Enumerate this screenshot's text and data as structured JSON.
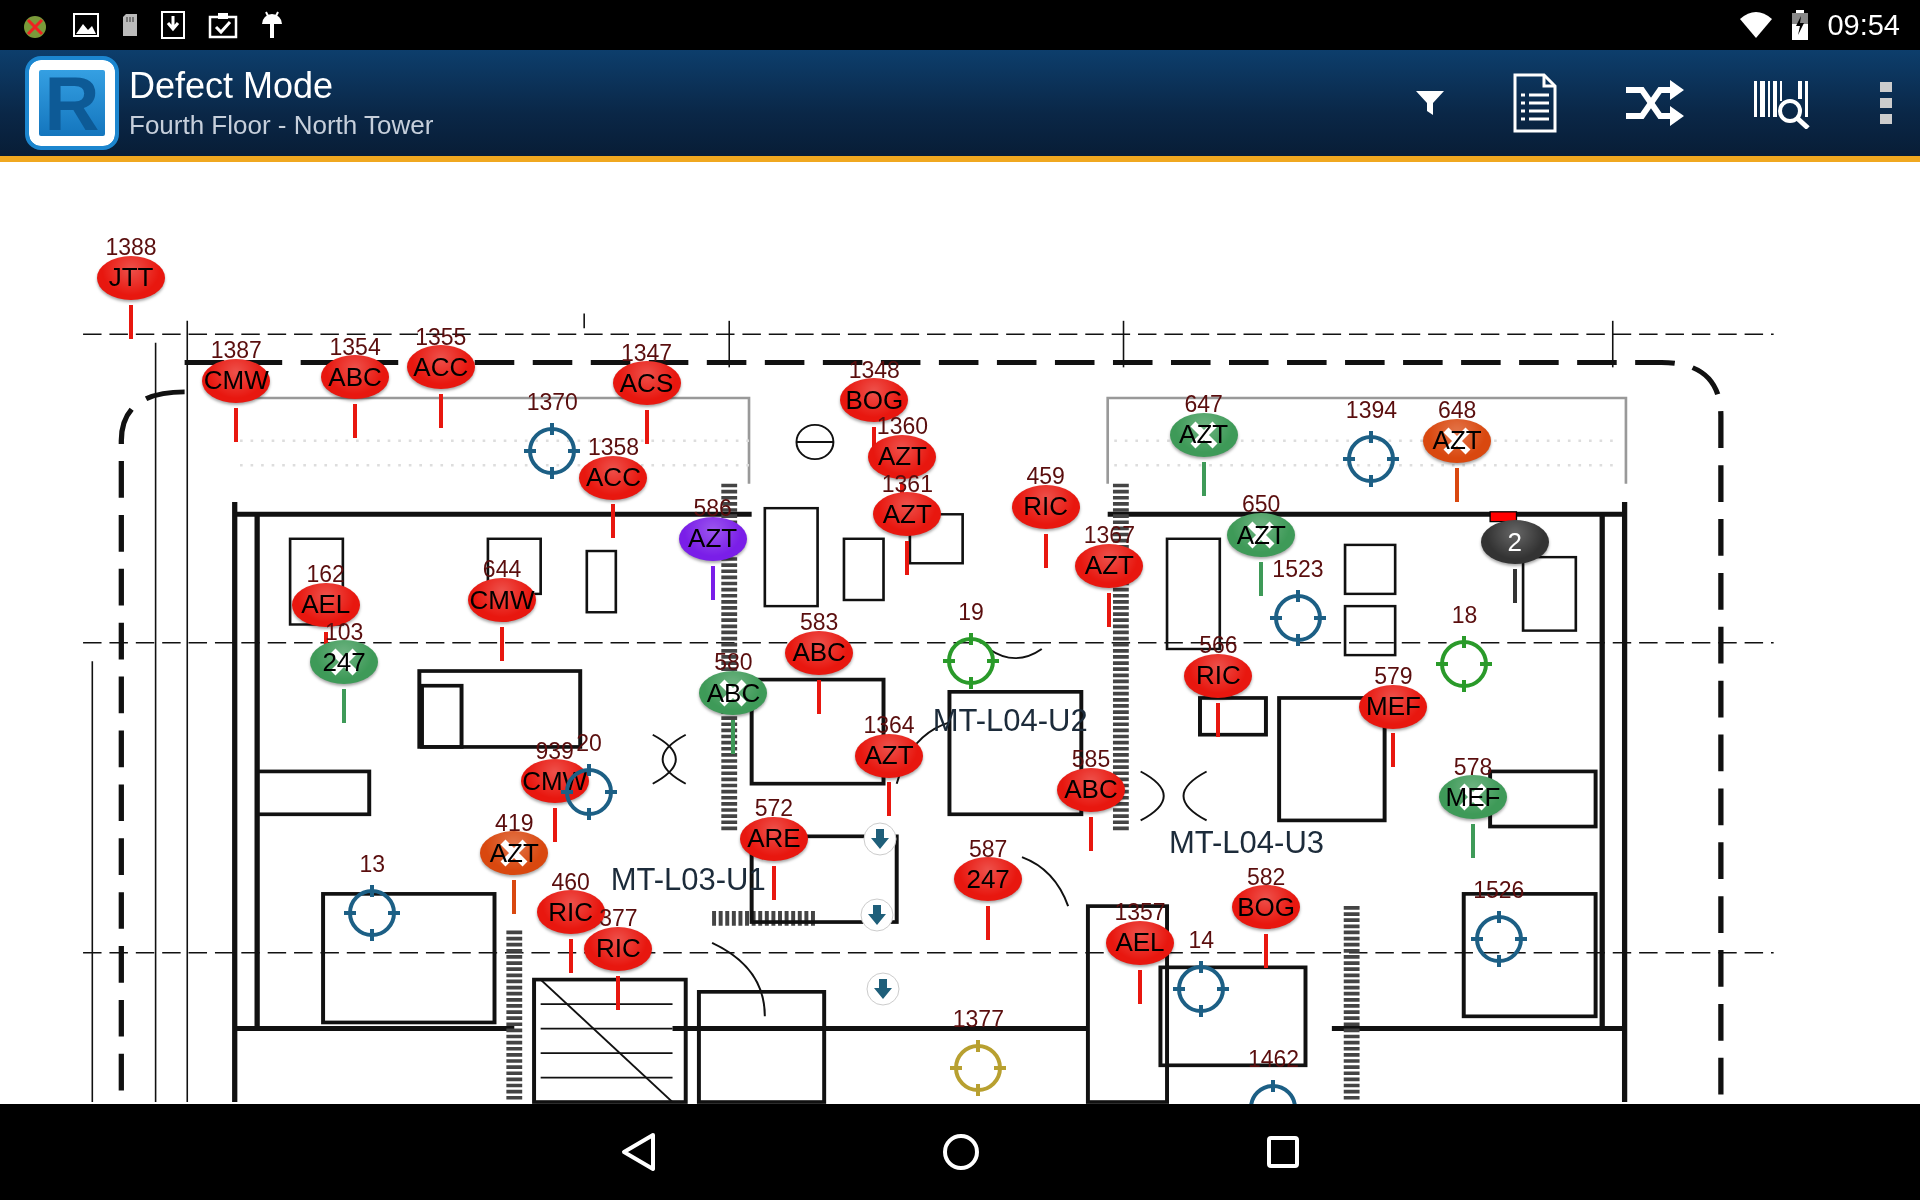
{
  "status_bar": {
    "time": "09:54"
  },
  "app_bar": {
    "logo_letter": "R",
    "title": "Defect Mode",
    "subtitle": "Fourth Floor - North Tower"
  },
  "plan": {
    "room_labels": [
      "MT-L04-U2",
      "MT-L03-U1",
      "MT-L04-U3"
    ],
    "markers": [
      {
        "kind": "pin",
        "number": "1388",
        "code": "JTT",
        "color": "#e8170f",
        "crossed": false
      },
      {
        "kind": "pin",
        "number": "1387",
        "code": "CMW",
        "color": "#e8170f",
        "crossed": false
      },
      {
        "kind": "pin",
        "number": "1354",
        "code": "ABC",
        "color": "#e8170f",
        "crossed": false
      },
      {
        "kind": "pin",
        "number": "1355",
        "code": "ACC",
        "color": "#e8170f",
        "crossed": false
      },
      {
        "kind": "pin",
        "number": "1347",
        "code": "ACS",
        "color": "#e8170f",
        "crossed": false
      },
      {
        "kind": "pin",
        "number": "1348",
        "code": "BOG",
        "color": "#e8170f",
        "crossed": false
      },
      {
        "kind": "pin",
        "number": "647",
        "code": "AZT",
        "color": "#3e9a58",
        "crossed": true
      },
      {
        "kind": "pin",
        "number": "648",
        "code": "AZT",
        "color": "#d9480f",
        "crossed": true
      },
      {
        "kind": "target",
        "number": "1370",
        "color": "#1c5f85"
      },
      {
        "kind": "target",
        "number": "1394",
        "color": "#1c5f85"
      },
      {
        "kind": "pin",
        "number": "1360",
        "code": "AZT",
        "color": "#e8170f",
        "crossed": false
      },
      {
        "kind": "pin",
        "number": "1358",
        "code": "ACC",
        "color": "#e8170f",
        "crossed": false
      },
      {
        "kind": "pin",
        "number": "459",
        "code": "RIC",
        "color": "#e8170f",
        "crossed": false
      },
      {
        "kind": "pin",
        "number": "1361",
        "code": "AZT",
        "color": "#e8170f",
        "crossed": false
      },
      {
        "kind": "pin",
        "number": "586",
        "code": "AZT",
        "color": "#7a1ee8",
        "crossed": false
      },
      {
        "kind": "pin",
        "number": "650",
        "code": "AZT",
        "color": "#3e9a58",
        "crossed": true
      },
      {
        "kind": "pin",
        "number": "1367",
        "code": "AZT",
        "color": "#e8170f",
        "crossed": false
      },
      {
        "kind": "pin",
        "code": "2",
        "color": "#333333",
        "crossed": false
      },
      {
        "kind": "pin",
        "number": "162",
        "code": "AEL",
        "color": "#e8170f",
        "crossed": false
      },
      {
        "kind": "pin",
        "number": "644",
        "code": "CMW",
        "color": "#e8170f",
        "crossed": false
      },
      {
        "kind": "target",
        "number": "1523",
        "color": "#1c5f85"
      },
      {
        "kind": "pin",
        "number": "103",
        "code": "247",
        "color": "#3e9a58",
        "crossed": true
      },
      {
        "kind": "pin",
        "number": "580",
        "code": "ABC",
        "color": "#3e9a58",
        "crossed": true
      },
      {
        "kind": "pin",
        "number": "583",
        "code": "ABC",
        "color": "#e8170f",
        "crossed": false
      },
      {
        "kind": "target",
        "number": "19",
        "color": "#2a9a2a"
      },
      {
        "kind": "pin",
        "number": "566",
        "code": "RIC",
        "color": "#e8170f",
        "crossed": false
      },
      {
        "kind": "pin",
        "number": "579",
        "code": "MEF",
        "color": "#e8170f",
        "crossed": false
      },
      {
        "kind": "target",
        "number": "18",
        "color": "#2a9a2a"
      },
      {
        "kind": "pin",
        "number": "939",
        "code": "CMW",
        "color": "#e8170f",
        "crossed": false
      },
      {
        "kind": "target",
        "number": "20",
        "color": "#1c5f85"
      },
      {
        "kind": "pin",
        "number": "1364",
        "code": "AZT",
        "color": "#e8170f",
        "crossed": false
      },
      {
        "kind": "pin",
        "number": "585",
        "code": "ABC",
        "color": "#e8170f",
        "crossed": false
      },
      {
        "kind": "pin",
        "number": "578",
        "code": "MEF",
        "color": "#3e9a58",
        "crossed": true
      },
      {
        "kind": "target",
        "number": "13",
        "color": "#1c5f85"
      },
      {
        "kind": "pin",
        "number": "419",
        "code": "AZT",
        "color": "#d9480f",
        "crossed": true
      },
      {
        "kind": "pin",
        "number": "460",
        "code": "RIC",
        "color": "#e8170f",
        "crossed": false
      },
      {
        "kind": "pin",
        "number": "377",
        "code": "RIC",
        "color": "#e8170f",
        "crossed": false
      },
      {
        "kind": "pin",
        "number": "572",
        "code": "ARE",
        "color": "#e8170f",
        "crossed": false
      },
      {
        "kind": "pin",
        "number": "587",
        "code": "247",
        "color": "#e8170f",
        "crossed": false
      },
      {
        "kind": "pin",
        "number": "1357",
        "code": "AEL",
        "color": "#e8170f",
        "crossed": false
      },
      {
        "kind": "pin",
        "number": "582",
        "code": "BOG",
        "color": "#e8170f",
        "crossed": false
      },
      {
        "kind": "target",
        "number": "1377",
        "color": "#b8a030"
      },
      {
        "kind": "target",
        "number": "14",
        "color": "#1c5f85"
      },
      {
        "kind": "target",
        "number": "1462",
        "color": "#1c5f85"
      },
      {
        "kind": "target",
        "number": "1526",
        "color": "#1c5f85"
      }
    ]
  }
}
